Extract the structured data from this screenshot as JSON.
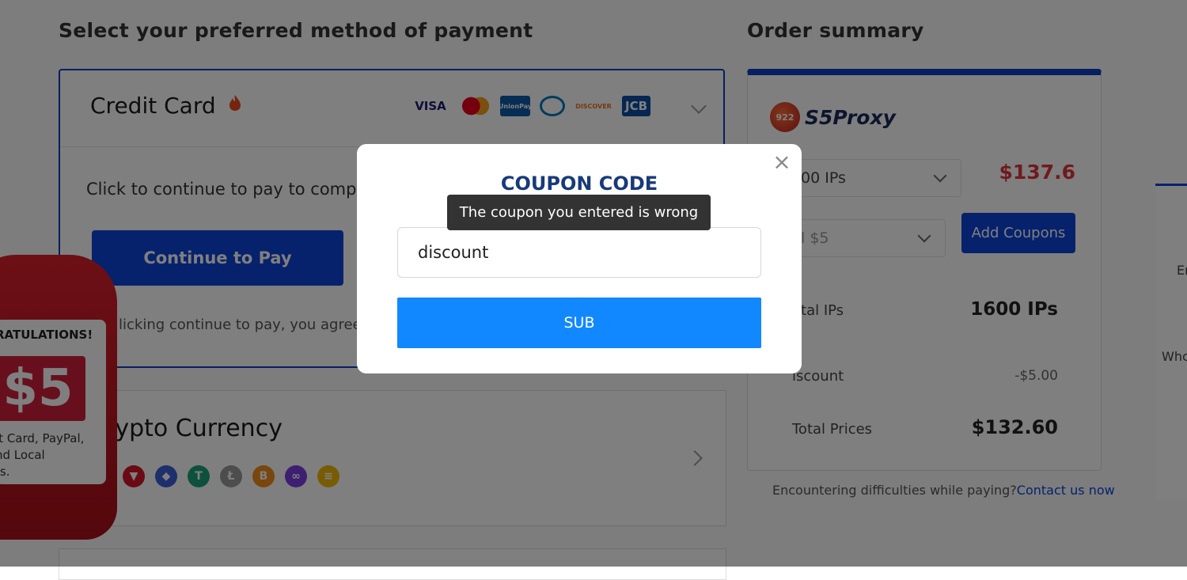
{
  "payment": {
    "heading": "Select your preferred method of payment",
    "credit_card": {
      "title": "Credit Card",
      "brands": [
        {
          "label": "VISA",
          "color": "#1a1f71",
          "bg": "#ffffff"
        },
        {
          "label": "",
          "color": "#eb001b",
          "bg": "#ffffff"
        },
        {
          "label": "UnionPay",
          "color": "#ffffff",
          "bg": "#0c5aa6"
        },
        {
          "label": "",
          "color": "#0079be",
          "bg": "#ffffff"
        },
        {
          "label": "DISCOVER",
          "color": "#f37021",
          "bg": "#ffffff"
        },
        {
          "label": "JCB",
          "color": "#ffffff",
          "bg": "#0b4ea2"
        }
      ],
      "description": "Click to continue to pay to comple",
      "continue_label": "Continue to Pay",
      "agree_text": "licking continue to pay, you agree"
    },
    "crypto": {
      "title": "rypto Currency",
      "coins": [
        {
          "symbol": "▼",
          "color": "#d4142b"
        },
        {
          "symbol": "◆",
          "color": "#3d5fd9"
        },
        {
          "symbol": "T",
          "color": "#1ba37a"
        },
        {
          "symbol": "Ł",
          "color": "#9a9a9a"
        },
        {
          "symbol": "B",
          "color": "#f28c1a"
        },
        {
          "symbol": "∞",
          "color": "#7b3fe4"
        },
        {
          "symbol": "≡",
          "color": "#f0b90b"
        }
      ]
    }
  },
  "summary": {
    "heading": "Order summary",
    "brand": "S5Proxy",
    "brand_badge": "922",
    "plan_select": "00 IPs",
    "price": "$137.6",
    "coupon_select": "l  $5",
    "add_coupons_label": "Add Coupons",
    "rows": [
      {
        "label": "otal IPs",
        "value": "1600 IPs"
      },
      {
        "label": "iscount",
        "value": "-$5.00"
      },
      {
        "label": "Total Prices",
        "value": "$132.60"
      }
    ],
    "help_text": "Encountering difficulties while paying?",
    "help_link": "Contact us now"
  },
  "side": {
    "text1": "Er",
    "text2": "Whc"
  },
  "gift": {
    "congrats": "RATULATIONS!",
    "amount": "$5",
    "text": "it Card, PayPal,\nnd Local\nts."
  },
  "modal": {
    "title": "COUPON CODE",
    "tooltip": "The coupon you entered is wrong",
    "input_value": "discount",
    "submit_label": "SUB",
    "close_symbol": "×"
  }
}
